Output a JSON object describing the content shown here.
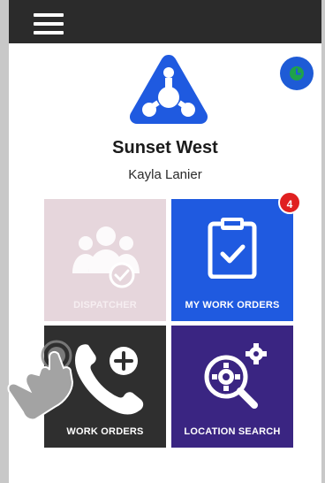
{
  "header": {
    "menu_icon": "hamburger-icon"
  },
  "status": {
    "clock_icon": "clock-icon",
    "accent": "#1e5bd6",
    "icon_color": "#1fa24a"
  },
  "company": {
    "name": "Sunset West",
    "logo": "triangle-nodes-logo",
    "brand_color": "#1f5ae0"
  },
  "user": {
    "name": "Kayla Lanier"
  },
  "tiles": [
    {
      "label": "DISPATCHER",
      "icon": "team-check-icon",
      "bg": "#e6d6dc",
      "enabled": false
    },
    {
      "label": "MY WORK ORDERS",
      "icon": "clipboard-check-icon",
      "bg": "#1f5ae0",
      "badge": "4"
    },
    {
      "label": "WORK ORDERS",
      "icon": "phone-add-icon",
      "bg": "#2f2f2f"
    },
    {
      "label": "LOCATION SEARCH",
      "icon": "gear-search-icon",
      "bg": "#3a2582"
    }
  ],
  "overlay": {
    "icon": "tap-hand-icon"
  }
}
